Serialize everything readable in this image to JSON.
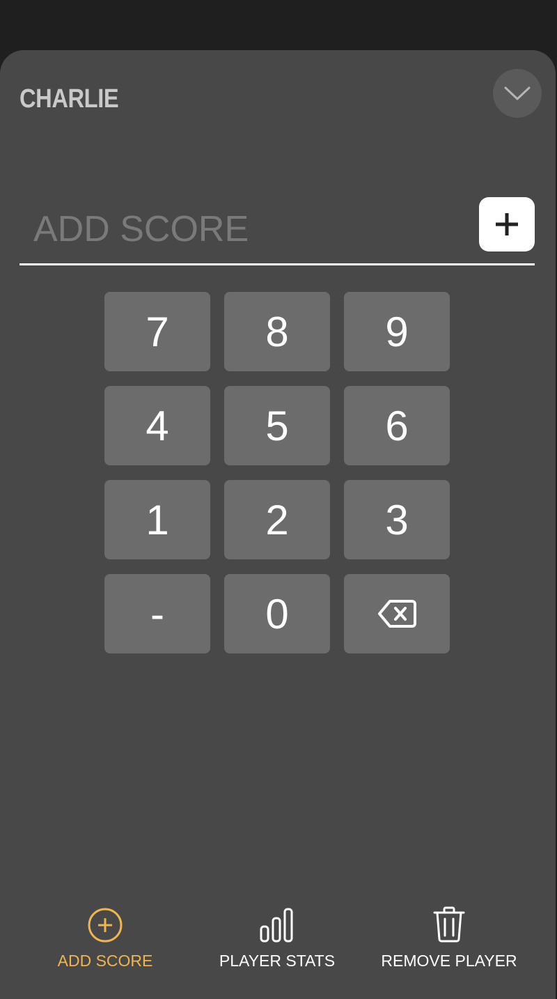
{
  "player": {
    "name": "CHARLIE"
  },
  "score_entry": {
    "placeholder": "ADD SCORE",
    "value": ""
  },
  "keypad": {
    "keys": [
      "7",
      "8",
      "9",
      "4",
      "5",
      "6",
      "1",
      "2",
      "3",
      "-",
      "0"
    ],
    "backspace_icon": "backspace-icon"
  },
  "nav": {
    "items": [
      {
        "label": "ADD SCORE",
        "icon": "plus-circle-icon",
        "active": true
      },
      {
        "label": "PLAYER STATS",
        "icon": "bar-chart-icon",
        "active": false
      },
      {
        "label": "REMOVE PLAYER",
        "icon": "trash-icon",
        "active": false
      }
    ]
  },
  "colors": {
    "background": "#1f1f1f",
    "sheet": "#484848",
    "key": "#6c6c6c",
    "accent": "#f0b450",
    "text": "#ffffff"
  }
}
